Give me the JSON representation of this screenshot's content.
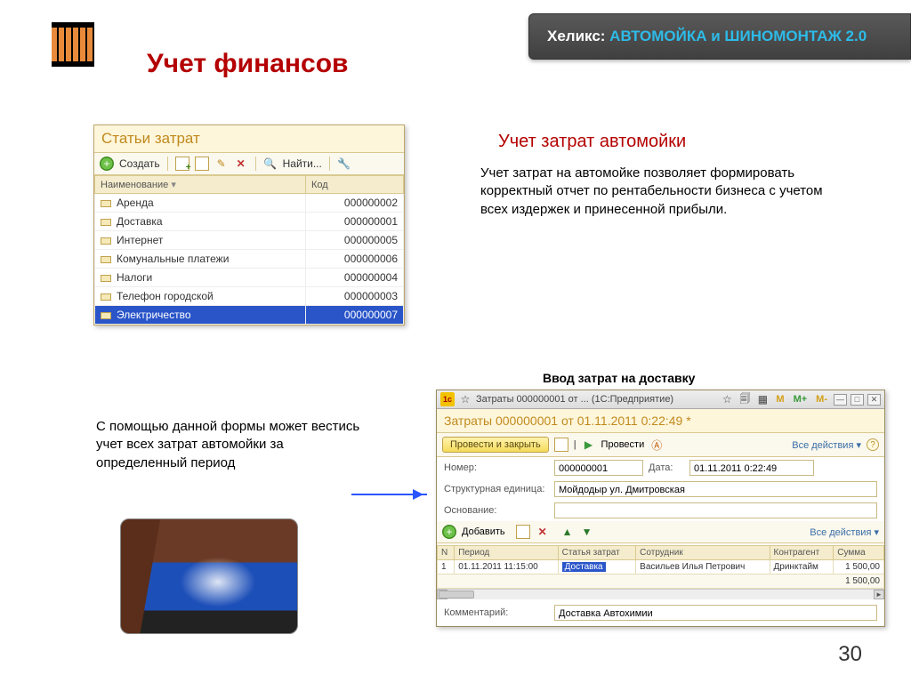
{
  "badge": {
    "prefix": "Хеликс: ",
    "brand": "АВТОМОЙКА и ШИНОМОНТАЖ 2.0"
  },
  "page_title": "Учет финансов",
  "section_heading": "Учет затрат автомойки",
  "section_text": "Учет затрат на автомойке позволяет формировать корректный отчет по рентабельности бизнеса с учетом всех издержек и принесенной прибыли.",
  "panel2_caption": "Ввод затрат на доставку",
  "form_help_text": "С помощью данной формы может вестись учет всех затрат автомойки за определенный период",
  "page_number": "30",
  "cost_items": {
    "title": "Статьи затрат",
    "toolbar": {
      "create": "Создать",
      "find": "Найти..."
    },
    "columns": {
      "name": "Наименование",
      "code": "Код"
    },
    "rows": [
      {
        "name": "Аренда",
        "code": "000000002"
      },
      {
        "name": "Доставка",
        "code": "000000001"
      },
      {
        "name": "Интернет",
        "code": "000000005"
      },
      {
        "name": "Комунальные платежи",
        "code": "000000006"
      },
      {
        "name": "Налоги",
        "code": "000000004"
      },
      {
        "name": "Телефон городской",
        "code": "000000003"
      },
      {
        "name": "Электричество",
        "code": "000000007"
      }
    ],
    "selected_index": 6
  },
  "expense_form": {
    "window_title": "Затраты 000000001 от ... (1С:Предприятие)",
    "header": "Затраты 000000001 от 01.11.2011 0:22:49 *",
    "toolbar": {
      "post_close": "Провести и закрыть",
      "post": "Провести",
      "all_actions": "Все действия"
    },
    "fields": {
      "number_label": "Номер:",
      "number": "000000001",
      "date_label": "Дата:",
      "date": "01.11.2011 0:22:49",
      "unit_label": "Структурная единица:",
      "unit": "Мойдодыр ул. Дмитровская",
      "basis_label": "Основание:",
      "basis": "",
      "comment_label": "Комментарий:",
      "comment": "Доставка Автохимии"
    },
    "lines_toolbar": {
      "add": "Добавить",
      "all_actions": "Все действия"
    },
    "columns": {
      "n": "N",
      "period": "Период",
      "item": "Статья затрат",
      "employee": "Сотрудник",
      "counterparty": "Контрагент",
      "sum": "Сумма"
    },
    "rows": [
      {
        "n": "1",
        "period": "01.11.2011 11:15:00",
        "item": "Доставка",
        "employee": "Васильев Илья Петрович",
        "counterparty": "Дринктайм",
        "sum": "1 500,00"
      }
    ],
    "total": "1 500,00"
  }
}
